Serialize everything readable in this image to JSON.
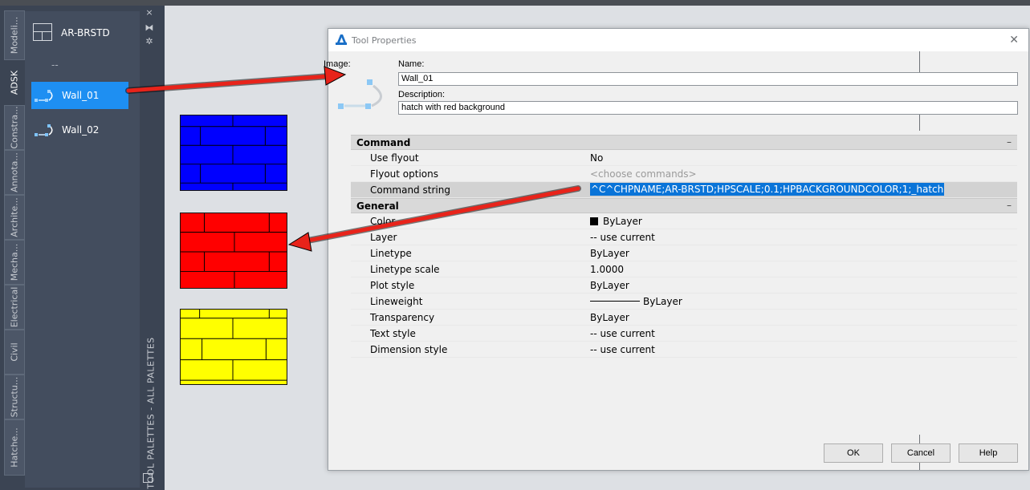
{
  "palette": {
    "vertical_tabs": [
      "Modeli...",
      "ADSK",
      "Constra...",
      "Annota...",
      "Archite...",
      "Mecha...",
      "Electrical",
      "Civil",
      "Structu...",
      "Hatche..."
    ],
    "active_tab": "ADSK",
    "header_label": "AR-BRSTD",
    "separator": "--",
    "tools": [
      {
        "label": "Wall_01",
        "selected": true
      },
      {
        "label": "Wall_02",
        "selected": false
      }
    ],
    "side_title": "TOOL PALETTES - ALL PALETTES",
    "side_controls": {
      "close": "×",
      "autohide": "⧓",
      "properties": "✲"
    }
  },
  "swatches": [
    {
      "color": "#0000ff"
    },
    {
      "color": "#ff0000"
    },
    {
      "color": "#ffff00"
    }
  ],
  "dialog": {
    "title": "Tool Properties",
    "close_icon": "✕",
    "image_label": "Image:",
    "name_label": "Name:",
    "name_value": "Wall_01",
    "description_label": "Description:",
    "description_value": "hatch with red background",
    "sections": {
      "command": {
        "label": "Command",
        "collapse": "–",
        "rows": [
          {
            "key": "Use flyout",
            "value": "No"
          },
          {
            "key": "Flyout options",
            "value": "<choose commands>"
          },
          {
            "key": "Command string",
            "value": "^C^CHPNAME;AR-BRSTD;HPSCALE;0.1;HPBACKGROUNDCOLOR;1;_hatch"
          }
        ]
      },
      "general": {
        "label": "General",
        "collapse": "–",
        "rows": [
          {
            "key": "Color",
            "value": "ByLayer"
          },
          {
            "key": "Layer",
            "value": "-- use current"
          },
          {
            "key": "Linetype",
            "value": "ByLayer"
          },
          {
            "key": "Linetype scale",
            "value": "1.0000"
          },
          {
            "key": "Plot style",
            "value": "ByLayer"
          },
          {
            "key": "Lineweight",
            "value": "ByLayer"
          },
          {
            "key": "Transparency",
            "value": "ByLayer"
          },
          {
            "key": "Text style",
            "value": "-- use current"
          },
          {
            "key": "Dimension  style",
            "value": "-- use current"
          }
        ]
      }
    },
    "buttons": {
      "ok": "OK",
      "cancel": "Cancel",
      "help": "Help"
    }
  },
  "colors": {
    "palette_bg": "#3b4453",
    "selection_blue": "#1e8ff2",
    "highlight_blue": "#0a74d8",
    "arrow_red": "#e8231a"
  }
}
